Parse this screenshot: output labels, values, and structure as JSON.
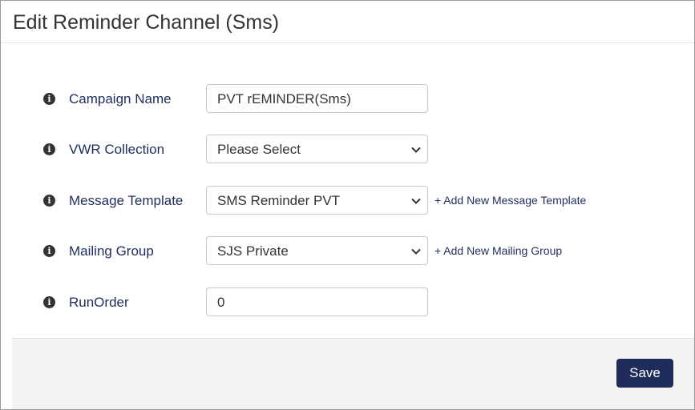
{
  "header": {
    "title": "Edit Reminder Channel (Sms)"
  },
  "form": {
    "campaign_name": {
      "label": "Campaign Name",
      "value": "PVT rEMINDER(Sms)",
      "icon": "info-icon"
    },
    "vwr_collection": {
      "label": "VWR Collection",
      "selected": "Please Select",
      "icon": "info-icon"
    },
    "message_template": {
      "label": "Message Template",
      "selected": "SMS Reminder PVT",
      "add_link": "+ Add New Message Template",
      "icon": "info-icon"
    },
    "mailing_group": {
      "label": "Mailing Group",
      "selected": "SJS Private",
      "add_link": "+ Add New Mailing Group",
      "icon": "info-icon"
    },
    "run_order": {
      "label": "RunOrder",
      "value": "0",
      "icon": "info-icon"
    }
  },
  "footer": {
    "save_label": "Save"
  },
  "colors": {
    "brand": "#1f2d5c",
    "footer_bg": "#f3f3f3",
    "border": "#c8c8c8"
  }
}
